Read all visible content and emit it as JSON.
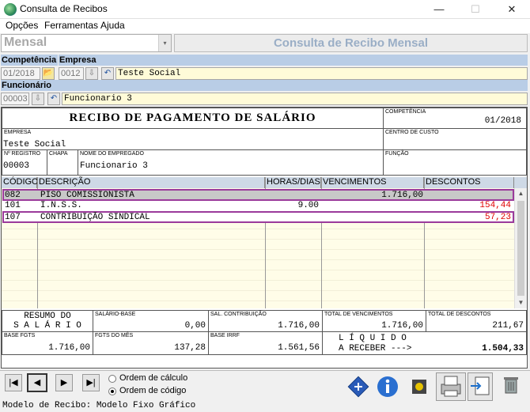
{
  "window": {
    "title": "Consulta de Recibos",
    "minimize": "—",
    "maximize": "☐",
    "close": "✕"
  },
  "menu": [
    "Opções",
    "Ferramentas",
    "Ajuda"
  ],
  "mode": {
    "value": "Mensal",
    "arrow": "▾"
  },
  "header_title": "Consulta de Recibo Mensal",
  "competencia": {
    "label": "Competência",
    "value": "01/2018"
  },
  "empresa": {
    "label": "Empresa",
    "code": "0012",
    "name": "Teste Social"
  },
  "funcionario": {
    "label": "Funcionário",
    "code": "00003",
    "name": "Funcionario 3"
  },
  "icons": {
    "folder": "📂",
    "lookup": "⇩",
    "undo": "↶"
  },
  "receipt": {
    "title": "RECIBO DE PAGAMENTO DE SALÁRIO",
    "competencia_label": "COMPETÊNCIA",
    "competencia": "01/2018",
    "empresa_label": "EMPRESA",
    "empresa": "Teste Social",
    "centro_label": "CENTRO DE CUSTO",
    "registro_label": "Nº REGISTRO",
    "registro": "00003",
    "chapa_label": "CHAPA",
    "nome_label": "NOME DO EMPREGADO",
    "nome": "Funcionario 3",
    "funcao_label": "FUNÇÃO",
    "columns": [
      "CÓDIGO",
      "DESCRIÇÃO",
      "HORAS/DIAS",
      "VENCIMENTOS",
      "DESCONTOS"
    ],
    "rows": [
      {
        "codigo": "082",
        "descricao": "PISO COMISSIONISTA",
        "horas": "",
        "vencimentos": "1.716,00",
        "descontos": ""
      },
      {
        "codigo": "101",
        "descricao": "I.N.S.S.",
        "horas": "9.00",
        "vencimentos": "",
        "descontos": "154,44"
      },
      {
        "codigo": "107",
        "descricao": "CONTRIBUIÇÃO SINDICAL",
        "horas": "",
        "vencimentos": "",
        "descontos": "57,23"
      }
    ],
    "resumo_l1": "RESUMO DO",
    "resumo_l2": "S A L Á R I O",
    "salario_base_label": "SALÁRIO-BASE",
    "salario_base": "0,00",
    "sal_contrib_label": "SAL. CONTRIBUIÇÃO",
    "sal_contrib": "1.716,00",
    "total_venc_label": "TOTAL DE VENCIMENTOS",
    "total_venc": "1.716,00",
    "total_desc_label": "TOTAL DE DESCONTOS",
    "total_desc": "211,67",
    "base_fgts_label": "BASE FGTS",
    "base_fgts": "1.716,00",
    "fgts_mes_label": "FGTS DO MÊS",
    "fgts_mes": "137,28",
    "base_irrf_label": "BASE IRRF",
    "base_irrf": "1.561,56",
    "liquido_l1": "L Í Q U I D O",
    "liquido_l2": "A RECEBER --->",
    "liquido": "1.504,33"
  },
  "nav": {
    "first": "|◀",
    "prev": "◀",
    "next": "▶",
    "last": "▶|"
  },
  "order": {
    "calc": "Ordem de cálculo",
    "code": "Ordem de código",
    "selected": "code"
  },
  "status": "Modelo de Recibo: Modelo Fixo Gráfico",
  "scroll": {
    "up": "▲",
    "down": "▼"
  },
  "colors": {
    "header_blue": "#b9cde6",
    "highlight": "#9b3a9b",
    "discount_red": "#e00000"
  }
}
